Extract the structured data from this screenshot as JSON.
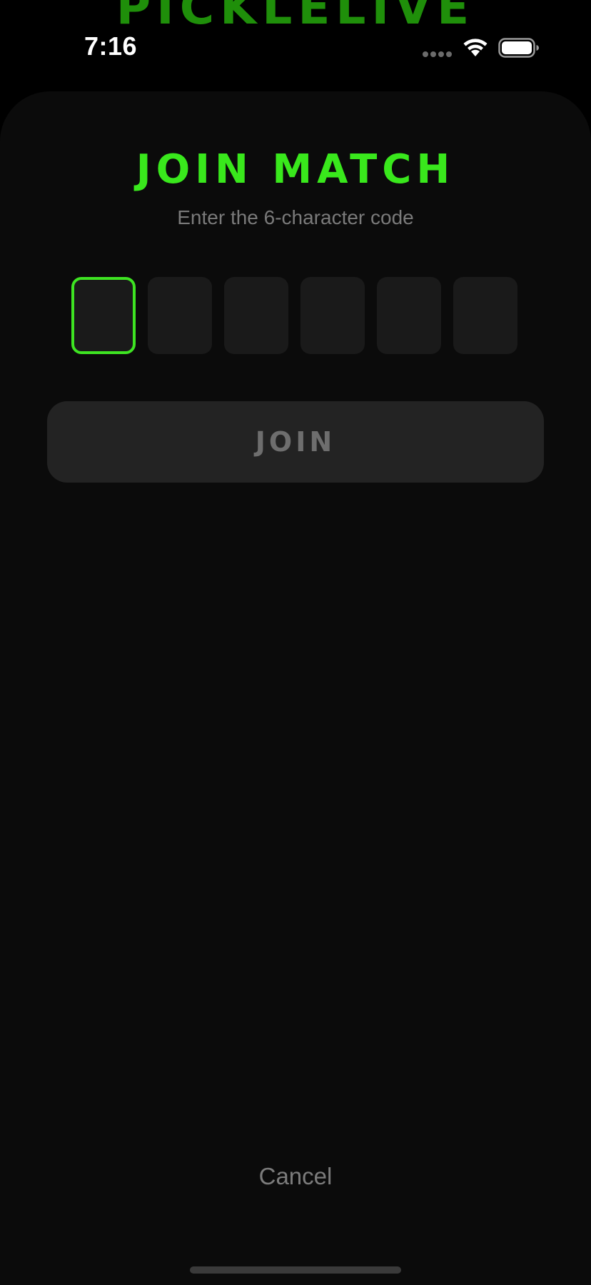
{
  "brand": {
    "background_title": "PICKLELIVE"
  },
  "status_bar": {
    "time": "7:16",
    "icons": [
      "signal-dots-icon",
      "wifi-icon",
      "battery-icon"
    ]
  },
  "sheet": {
    "title": "JOIN MATCH",
    "subtitle": "Enter the 6-character code",
    "code_length": 6,
    "active_index": 0,
    "code_values": [
      "",
      "",
      "",
      "",
      "",
      ""
    ],
    "join_label": "JOIN",
    "join_enabled": false,
    "cancel_label": "Cancel"
  },
  "colors": {
    "accent": "#39e81c",
    "brand_dim": "#1f8f0a",
    "sheet_bg": "#0b0b0b",
    "box_bg": "#1a1a1a",
    "button_disabled_bg": "#232323",
    "muted_text": "#7a7a7a"
  }
}
